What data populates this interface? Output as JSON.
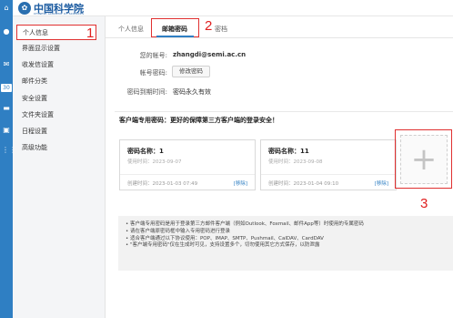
{
  "rail": {
    "icons": [
      "home-icon",
      "user-icon",
      "mail-icon",
      "calendar-icon",
      "folder-icon",
      "contacts-icon",
      "apps-grid-icon"
    ],
    "calendar_badge": "30"
  },
  "brand": {
    "emblem": "✿",
    "name": "中国科学院",
    "sub": "CHINESE ACADEMY OF SCIENCES"
  },
  "sidebar": {
    "items": [
      {
        "label": "个人信息"
      },
      {
        "label": "界面显示设置"
      },
      {
        "label": "收发信设置"
      },
      {
        "label": "邮件分类"
      },
      {
        "label": "安全设置"
      },
      {
        "label": "文件夹设置"
      },
      {
        "label": "日程设置"
      },
      {
        "label": "高级功能"
      }
    ]
  },
  "tabs": [
    {
      "label": "个人信息"
    },
    {
      "label": "邮箱密码"
    },
    {
      "label": "密档"
    }
  ],
  "annotations": {
    "a1": "1",
    "a2": "2",
    "a3": "3"
  },
  "account": {
    "account_label": "您的帐号:",
    "account_value": "zhangdi@semi.ac.cn",
    "password_label": "帐号密码:",
    "change_password_button": "修改密码",
    "expiry_label": "密码到期时间:",
    "expiry_value": "密码永久有效"
  },
  "client_pw": {
    "section_title": "客户端专用密码：更好的保障第三方客户端的登录安全！",
    "cards": [
      {
        "name": "密码名称：1",
        "used": "使用时间：2023-09-07",
        "created": "创建时间：2023-01-03 07:49",
        "delete": "[移除]"
      },
      {
        "name": "密码名称：11",
        "used": "使用时间：2023-09-08",
        "created": "创建时间：2023-01-04 09:10",
        "delete": "[移除]"
      }
    ],
    "add_symbol": "+"
  },
  "notes": [
    "• 客户端专用密码是用于登录第三方邮件客户端（例如Outlook、Foxmail、邮件App等）时使用的专属密码",
    "• 请在客户端原密码框中输入专用密码进行登录",
    "• 适合客户端通过以下协议使用：POP、IMAP、SMTP、Pushmail、CalDAV、CardDAV",
    "• \"客户端专用密码\"仅在生成时可见，支持设置多个，切勿使用其它方式保存，以防泄露"
  ]
}
